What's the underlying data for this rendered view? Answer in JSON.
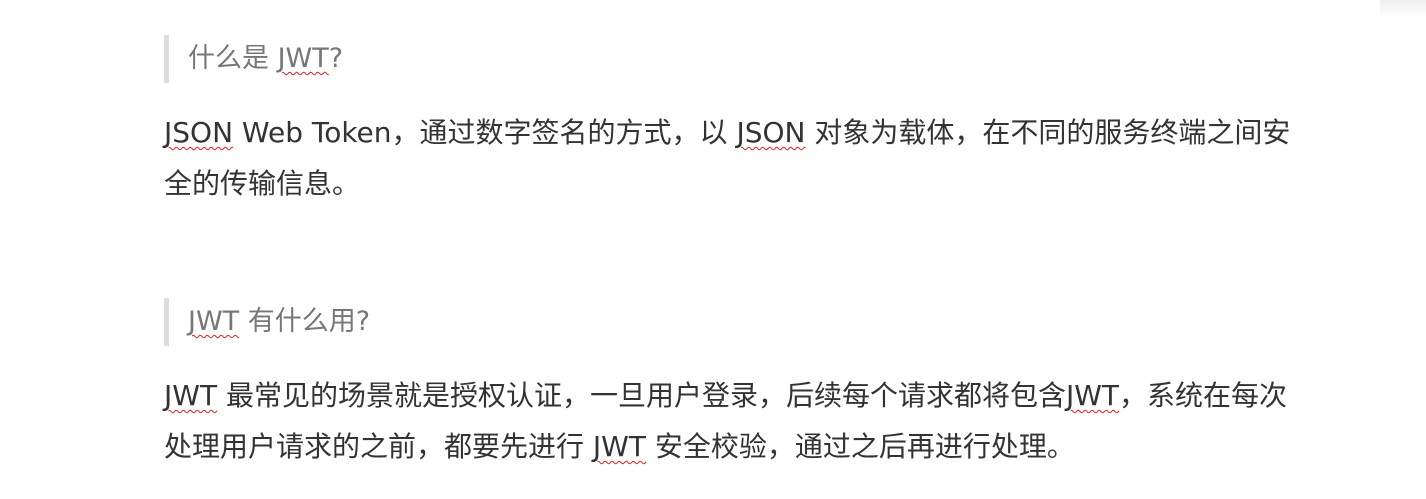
{
  "section1": {
    "heading": {
      "before": "什么是 ",
      "term": "JWT",
      "after": "?"
    },
    "paragraph": {
      "line1": {
        "term1": "JSON",
        "text1": " Web Token，通过数字签名的方式，以 ",
        "term2": "JSON",
        "text2": " 对象为载体，在不同的服务终端之间安"
      },
      "line2": "全的传输信息。"
    }
  },
  "section2": {
    "heading": {
      "term": "JWT",
      "after": " 有什么用?"
    },
    "paragraph": {
      "line1": {
        "term1": "JWT",
        "text1": " 最常见的场景就是授权认证，一旦用户登录，后续每个请求都将包含",
        "term2": "JWT",
        "text2": "，系统在每次"
      },
      "line2": {
        "text1": "处理用户请求的之前，都要先进行 ",
        "term": "JWT",
        "text2": " 安全校验，通过之后再进行处理。"
      }
    }
  },
  "colors": {
    "text": "#333333",
    "heading": "#777777",
    "quote_border": "#dddddd",
    "spellcheck": "#e02020"
  }
}
